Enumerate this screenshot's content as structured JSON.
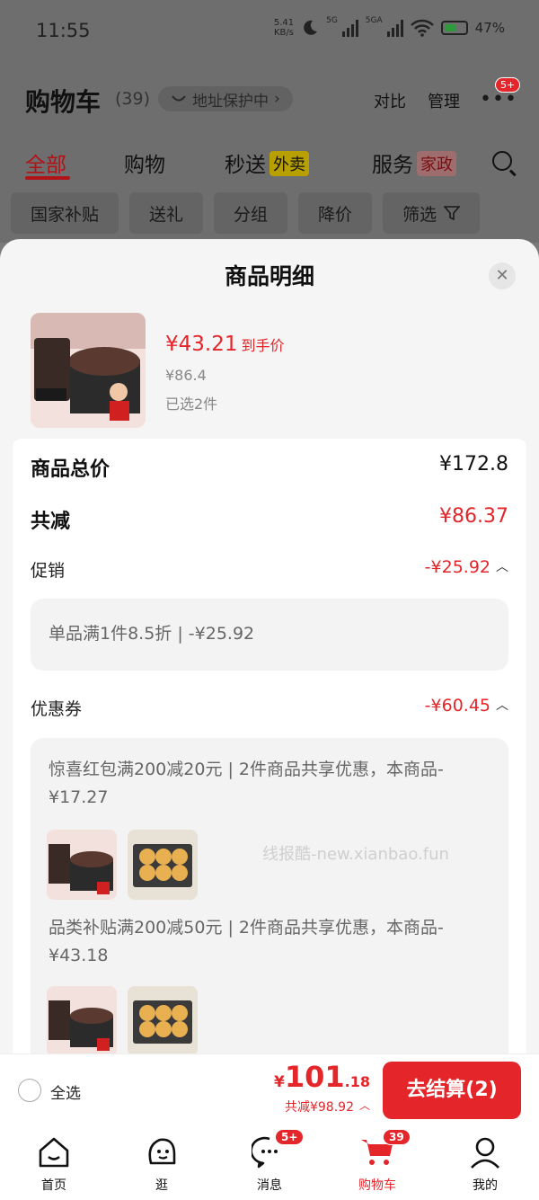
{
  "status": {
    "time": "11:55",
    "net_speed_value": "5.41",
    "net_speed_unit": "KB/s",
    "sig1": "5G",
    "sig2": "5GA",
    "battery": "47%"
  },
  "header": {
    "title": "购物车",
    "count": "(39)",
    "address": "地址保护中",
    "compare": "对比",
    "manage": "管理",
    "more_badge": "5+"
  },
  "tabs": {
    "all": "全部",
    "shopping": "购物",
    "express": "秒送",
    "express_tag": "外卖",
    "service": "服务",
    "service_tag": "家政"
  },
  "chips": [
    "国家补贴",
    "送礼",
    "分组",
    "降价",
    "筛选"
  ],
  "sheet": {
    "title": "商品明细",
    "product": {
      "price": "¥43.21",
      "price_note": "到手价",
      "original": "¥86.4",
      "selected": "已选2件"
    },
    "total_label": "商品总价",
    "total_value": "¥172.8",
    "discount_label": "共减",
    "discount_value": "¥86.37",
    "promo_label": "促销",
    "promo_value": "-¥25.92",
    "promo_detail": "单品满1件8.5折 | -¥25.92",
    "coupon_label": "优惠券",
    "coupon_value": "-¥60.45",
    "coupon1": "惊喜红包满200减20元 | 2件商品共享优惠，本商品-¥17.27",
    "coupon2": "品类补贴满200减50元 | 2件商品共享优惠，本商品-¥43.18",
    "watermark": "线报酷-new.xianbao.fun"
  },
  "checkout": {
    "select_all": "全选",
    "currency": "¥",
    "total_int": "101",
    "total_dec": ".18",
    "saved": "共减¥98.92",
    "button": "去结算(2)"
  },
  "nav": [
    {
      "label": "首页",
      "icon": "home-icon"
    },
    {
      "label": "逛",
      "icon": "discover-icon"
    },
    {
      "label": "消息",
      "icon": "message-icon",
      "badge": "5+"
    },
    {
      "label": "购物车",
      "icon": "cart-icon",
      "badge": "39"
    },
    {
      "label": "我的",
      "icon": "profile-icon"
    }
  ],
  "colors": {
    "accent": "#e4262b",
    "dark_red": "#b01318"
  }
}
